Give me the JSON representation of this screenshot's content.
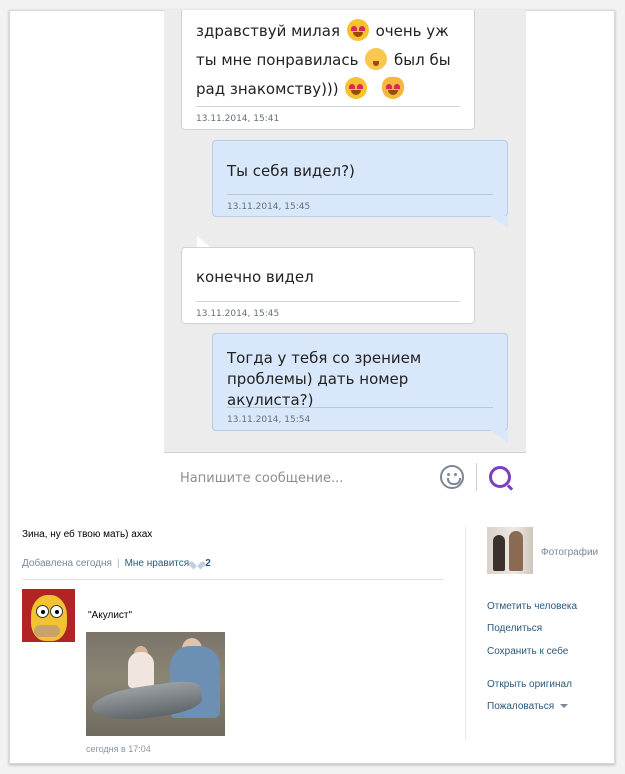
{
  "chat": {
    "messages": [
      {
        "direction": "in",
        "lines": [
          "здравствуй милая",
          "очень уж",
          "ты мне понравилась",
          "был бы",
          "рад знакомству)))"
        ],
        "emojis": [
          "heart-eyes-emoji",
          "kiss-emoji",
          "heart-eyes-emoji",
          "cat-heart-eyes-emoji"
        ],
        "time": "13.11.2014, 15:41"
      },
      {
        "direction": "out",
        "text": "Ты себя видел?)",
        "time": "13.11.2014, 15:45"
      },
      {
        "direction": "in",
        "text": "конечно видел",
        "time": "13.11.2014, 15:45"
      },
      {
        "direction": "out",
        "lines": [
          "Тогда у тебя со зрением",
          "проблемы) дать номер акулиста?)"
        ],
        "time": "13.11.2014, 15:54"
      }
    ],
    "composer": {
      "placeholder": "Напишите сообщение...",
      "emoji_icon": "smiley-icon",
      "send_icon": "send-icon"
    }
  },
  "post": {
    "text": "Зина, ну еб твою мать) ахах",
    "added": "Добавлена сегодня",
    "like_label": "Мне нравится",
    "like_count": "2",
    "comment": {
      "author": "\"Акулист\"",
      "time": "сегодня в 17:04"
    }
  },
  "sidebar": {
    "photos_label": "Фотографии",
    "actions": [
      "Отметить человека",
      "Поделиться",
      "Сохранить к себе",
      "Открыть оригинал",
      "Пожаловаться"
    ]
  },
  "colors": {
    "incoming_bubble": "#ffffff",
    "outgoing_bubble": "#d8e7fa",
    "link": "#2b587a",
    "send_accent": "#7b3fbf"
  }
}
